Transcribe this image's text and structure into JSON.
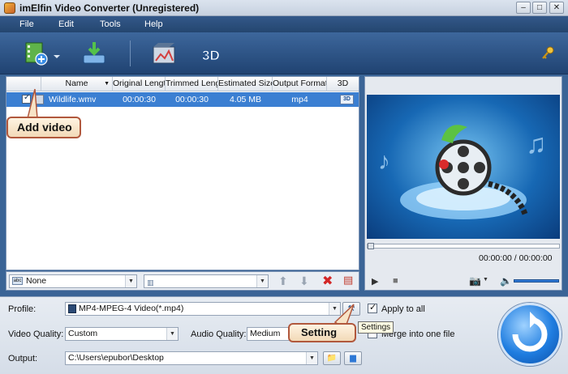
{
  "window": {
    "title": "imElfin Video Converter (Unregistered)"
  },
  "menu": {
    "items": [
      "File",
      "Edit",
      "Tools",
      "Help"
    ]
  },
  "table": {
    "headers": [
      "Name",
      "Original Length",
      "Trimmed Length",
      "Estimated Size",
      "Output Format",
      "3D"
    ],
    "rows": [
      {
        "name": "Wildlife.wmv",
        "original": "00:00:30",
        "trimmed": "00:00:30",
        "size": "4.05 MB",
        "format": "mp4",
        "badge": "3D"
      }
    ]
  },
  "annotations": {
    "add_video": "Add video",
    "setting": "Setting"
  },
  "list_footer": {
    "subtitle_value": "None"
  },
  "preview": {
    "time": "00:00:00 / 00:00:00"
  },
  "settings": {
    "profile_label": "Profile:",
    "profile_value": "MP4-MPEG-4 Video(*.mp4)",
    "apply_all": "Apply to all",
    "video_quality_label": "Video Quality:",
    "video_quality_value": "Custom",
    "audio_quality_label": "Audio Quality:",
    "audio_quality_value": "Medium",
    "merge": "Merge into one file",
    "output_label": "Output:",
    "output_value": "C:\\Users\\epubor\\Desktop",
    "tooltip": "Settings"
  },
  "colors": {
    "accent": "#3b7fd2",
    "toolbar": "#2a558a",
    "callout_border": "#b1583d"
  }
}
